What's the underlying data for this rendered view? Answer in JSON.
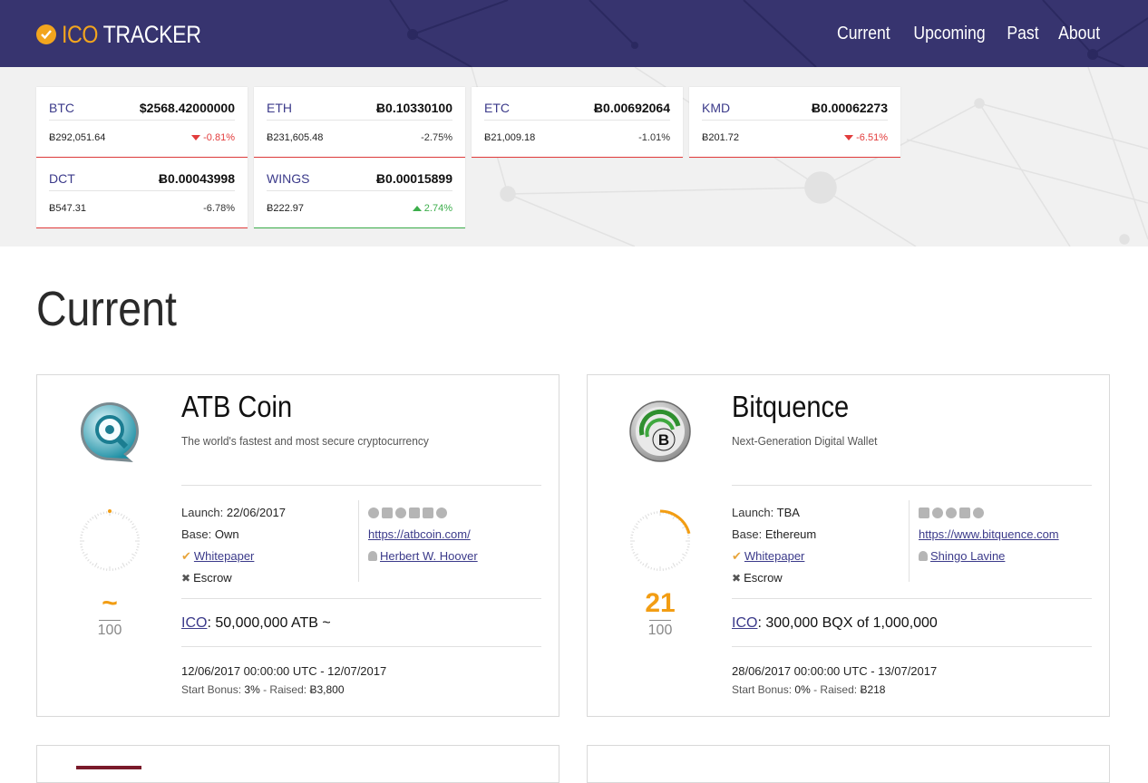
{
  "header": {
    "logo_ico": "ICO",
    "logo_tracker": "TRACKER",
    "nav": [
      "Current",
      "Upcoming",
      "Past",
      "About"
    ]
  },
  "tickers": [
    {
      "symbol": "BTC",
      "price": "$2568.42000000",
      "volume": "Ƀ292,051.64",
      "change": "-0.81%",
      "direction": "down"
    },
    {
      "symbol": "ETH",
      "price": "Ƀ0.10330100",
      "volume": "Ƀ231,605.48",
      "change": "-2.75%",
      "direction": "flat"
    },
    {
      "symbol": "ETC",
      "price": "Ƀ0.00692064",
      "volume": "Ƀ21,009.18",
      "change": "-1.01%",
      "direction": "flat"
    },
    {
      "symbol": "KMD",
      "price": "Ƀ0.00062273",
      "volume": "Ƀ201.72",
      "change": "-6.51%",
      "direction": "down"
    },
    {
      "symbol": "DCT",
      "price": "Ƀ0.00043998",
      "volume": "Ƀ547.31",
      "change": "-6.78%",
      "direction": "flat"
    },
    {
      "symbol": "WINGS",
      "price": "Ƀ0.00015899",
      "volume": "Ƀ222.97",
      "change": "2.74%",
      "direction": "up"
    }
  ],
  "page_title": "Current",
  "cards": [
    {
      "name": "ATB Coin",
      "tagline": "The world's fastest and most secure cryptocurrency",
      "launch_label": "Launch:",
      "launch": "22/06/2017",
      "base_label": "Base:",
      "base": "Own",
      "whitepaper": "Whitepaper",
      "escrow": "Escrow",
      "website": "https://atbcoin.com/",
      "person": "Herbert W. Hoover",
      "score": "~",
      "score_max": "100",
      "score_fraction": 0,
      "ico_link": "ICO",
      "ico_text": ": 50,000,000 ATB ~",
      "dates": "12/06/2017 00:00:00 UTC - 12/07/2017",
      "bonus_label": "Start Bonus:",
      "bonus": "3%",
      "raised_label": "- Raised:",
      "raised": "Ƀ3,800",
      "logo_colors": {
        "ring": "#2a9eb1",
        "inner": "#d6f2f6"
      }
    },
    {
      "name": "Bitquence",
      "tagline": "Next-Generation Digital Wallet",
      "launch_label": "Launch:",
      "launch": "TBA",
      "base_label": "Base:",
      "base": "Ethereum",
      "whitepaper": "Whitepaper",
      "escrow": "Escrow",
      "website": "https://www.bitquence.com",
      "person": "Shingo Lavine",
      "score": "21",
      "score_max": "100",
      "score_fraction": 0.21,
      "ico_link": "ICO",
      "ico_text": ": 300,000 BQX of 1,000,000",
      "dates": "28/06/2017 00:00:00 UTC - 13/07/2017",
      "bonus_label": "Start Bonus:",
      "bonus": "0%",
      "raised_label": "- Raised:",
      "raised": "Ƀ218",
      "logo_colors": {
        "ring": "#2f8f2f",
        "inner": "#e8e8e8"
      }
    }
  ],
  "colors": {
    "header_bg": "#37346f",
    "accent": "#f2a51e",
    "link": "#3b3a8a",
    "negative": "#e23c3c",
    "positive": "#3cae4b"
  }
}
